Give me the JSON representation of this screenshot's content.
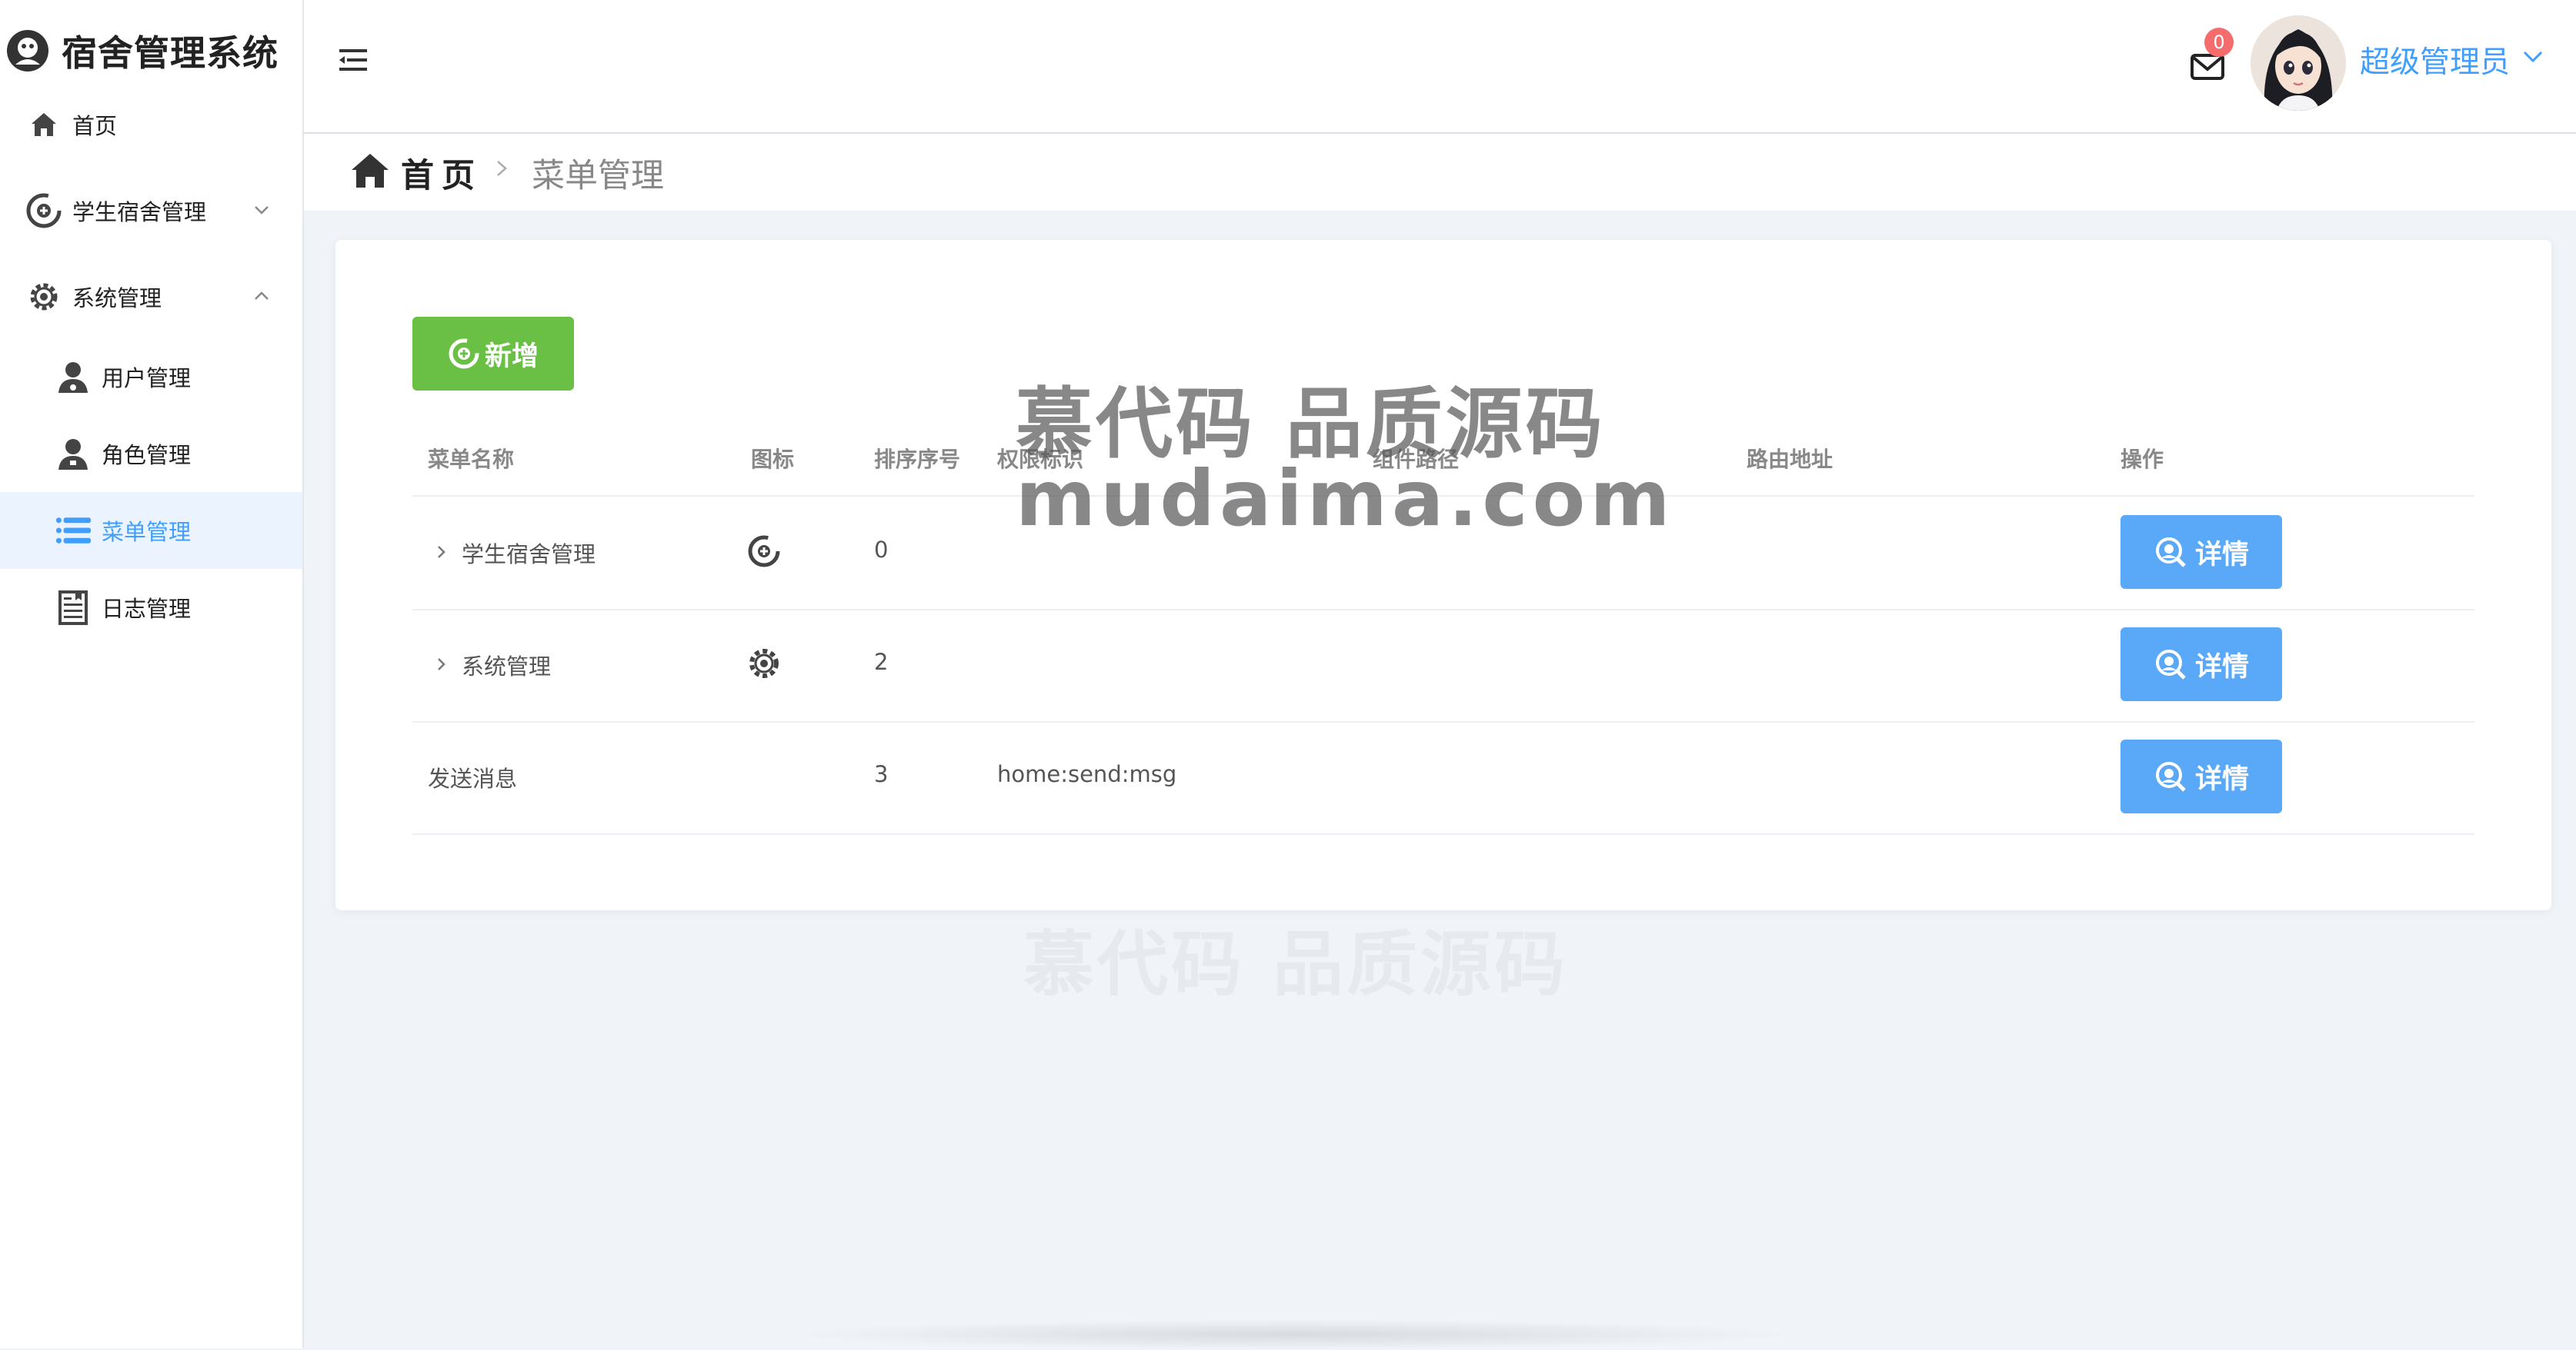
{
  "app": {
    "title": "宿舍管理系统"
  },
  "sidebar": {
    "items": [
      {
        "label": "首页"
      },
      {
        "label": "学生宿舍管理"
      },
      {
        "label": "系统管理"
      },
      {
        "label": "用户管理"
      },
      {
        "label": "角色管理"
      },
      {
        "label": "菜单管理"
      },
      {
        "label": "日志管理"
      }
    ],
    "active": "菜单管理"
  },
  "header": {
    "notification_count": "0",
    "user_name": "超级管理员"
  },
  "breadcrumb": {
    "home": "首页",
    "current": "菜单管理"
  },
  "toolbar": {
    "add_label": "新增"
  },
  "table": {
    "columns": [
      "菜单名称",
      "图标",
      "排序序号",
      "权限标识",
      "组件路径",
      "路由地址",
      "操作"
    ],
    "rows": [
      {
        "name": "学生宿舍管理",
        "icon": "plus-circle-icon",
        "order": "0",
        "perm": "",
        "component": "",
        "route": "",
        "action": "详情"
      },
      {
        "name": "系统管理",
        "icon": "gear-icon",
        "order": "2",
        "perm": "",
        "component": "",
        "route": "",
        "action": "详情"
      },
      {
        "name": "发送消息",
        "icon": "",
        "order": "3",
        "perm": "home:send:msg",
        "component": "",
        "route": "",
        "action": "详情"
      }
    ]
  },
  "watermark": {
    "line1": "慕代码 品质源码",
    "line2": "mudaima.com",
    "line3": "慕代码 品质源码"
  },
  "colors": {
    "primary": "#409eff",
    "success": "#6ac044",
    "detail": "#5aa8f8",
    "badge": "#f56c6c",
    "active_bg": "#ebf4fe"
  }
}
